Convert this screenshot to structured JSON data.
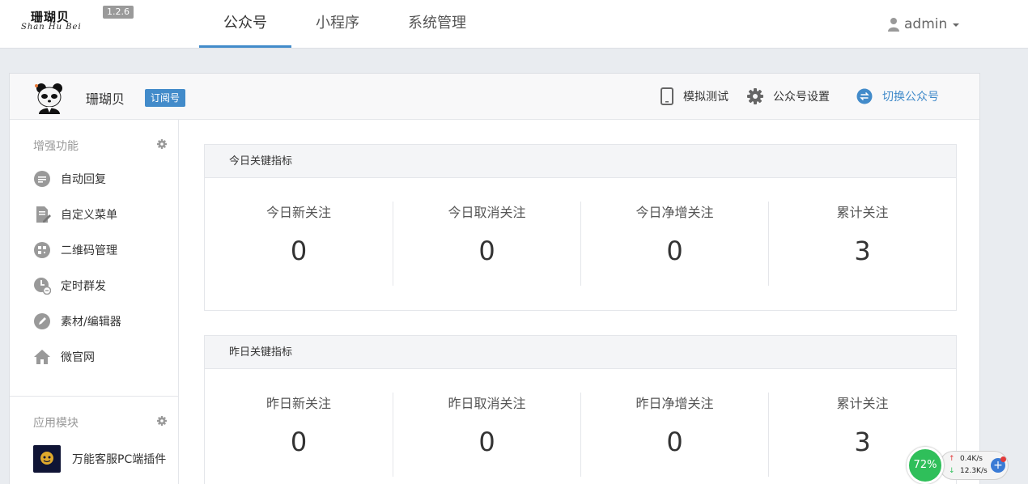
{
  "brand": {
    "logo_cn": "珊瑚贝",
    "logo_en": "Shan Hu Bei",
    "version": "1.2.6"
  },
  "nav": {
    "tabs": [
      {
        "label": "公众号",
        "active": true
      },
      {
        "label": "小程序",
        "active": false
      },
      {
        "label": "系统管理",
        "active": false
      }
    ]
  },
  "user": {
    "name": "admin"
  },
  "account": {
    "name": "珊瑚贝",
    "type_badge": "订阅号",
    "actions": {
      "simulate": "模拟测试",
      "settings": "公众号设置",
      "switch": "切换公众号"
    }
  },
  "sidebar": {
    "enhanced_heading": "增强功能",
    "items": [
      {
        "label": "自动回复",
        "icon": "chat-bubble-icon"
      },
      {
        "label": "自定义菜单",
        "icon": "edit-document-icon"
      },
      {
        "label": "二维码管理",
        "icon": "qrcode-icon"
      },
      {
        "label": "定时群发",
        "icon": "clock-icon"
      },
      {
        "label": "素材/编辑器",
        "icon": "pencil-icon"
      },
      {
        "label": "微官网",
        "icon": "home-icon"
      }
    ],
    "apps_heading": "应用模块",
    "apps": [
      {
        "label": "万能客服PC端插件"
      }
    ]
  },
  "today": {
    "title": "今日关键指标",
    "metrics": [
      {
        "label": "今日新关注",
        "value": "0"
      },
      {
        "label": "今日取消关注",
        "value": "0"
      },
      {
        "label": "今日净增关注",
        "value": "0"
      },
      {
        "label": "累计关注",
        "value": "3"
      }
    ]
  },
  "yesterday": {
    "title": "昨日关键指标",
    "metrics": [
      {
        "label": "昨日新关注",
        "value": "0"
      },
      {
        "label": "昨日取消关注",
        "value": "0"
      },
      {
        "label": "昨日净增关注",
        "value": "0"
      },
      {
        "label": "累计关注",
        "value": "3"
      }
    ]
  },
  "speed_widget": {
    "percent": "72%",
    "upload": "0.4K/s",
    "download": "12.3K/s",
    "plus": "+"
  },
  "colors": {
    "accent": "#428bca",
    "widget_green": "#2fbf5a"
  }
}
